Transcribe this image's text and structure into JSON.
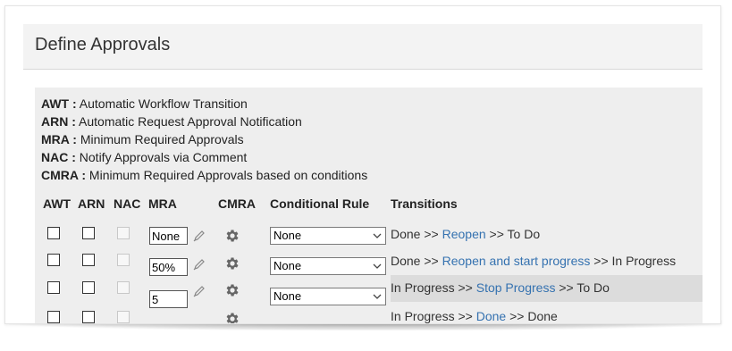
{
  "title": "Define Approvals",
  "legend": [
    {
      "abbr": "AWT :",
      "text": "Automatic Workflow Transition"
    },
    {
      "abbr": "ARN :",
      "text": "Automatic Request Approval Notification"
    },
    {
      "abbr": "MRA :",
      "text": "Minimum Required Approvals"
    },
    {
      "abbr": "NAC :",
      "text": "Notify Approvals via Comment"
    },
    {
      "abbr": "CMRA :",
      "text": "Minimum Required Approvals based on conditions"
    }
  ],
  "columns": {
    "awt": "AWT",
    "arn": "ARN",
    "nac": "NAC",
    "mra": "MRA",
    "cmra": "CMRA",
    "rule": "Conditional Rule",
    "transitions": "Transitions"
  },
  "rows": [
    {
      "mra": "None",
      "rule": "None",
      "from": "Done",
      "sep1": ">>",
      "link": "Reopen",
      "sep2": ">>",
      "to": "To Do",
      "highlighted": false
    },
    {
      "mra": "50%",
      "rule": "None",
      "from": "Done",
      "sep1": ">>",
      "link": "Reopen and start progress",
      "sep2": ">>",
      "to": "In Progress",
      "highlighted": false
    },
    {
      "mra": "5",
      "rule": "None",
      "from": "In Progress",
      "sep1": ">>",
      "link": "Stop Progress",
      "sep2": ">>",
      "to": "To Do",
      "highlighted": true
    },
    {
      "mra": "",
      "rule": "",
      "from": "In Progress",
      "sep1": ">>",
      "link": "Done",
      "sep2": ">>",
      "to": "Done",
      "highlighted": false
    }
  ],
  "icons": {
    "edit": "pencil-icon",
    "settings": "gear-icon",
    "dropdown": "chevron-down-icon"
  },
  "colors": {
    "link": "#3572b0",
    "header_bg": "#f3f3f3",
    "panel_bg": "#eeeeee",
    "highlight_bg": "#dcdcdc"
  }
}
